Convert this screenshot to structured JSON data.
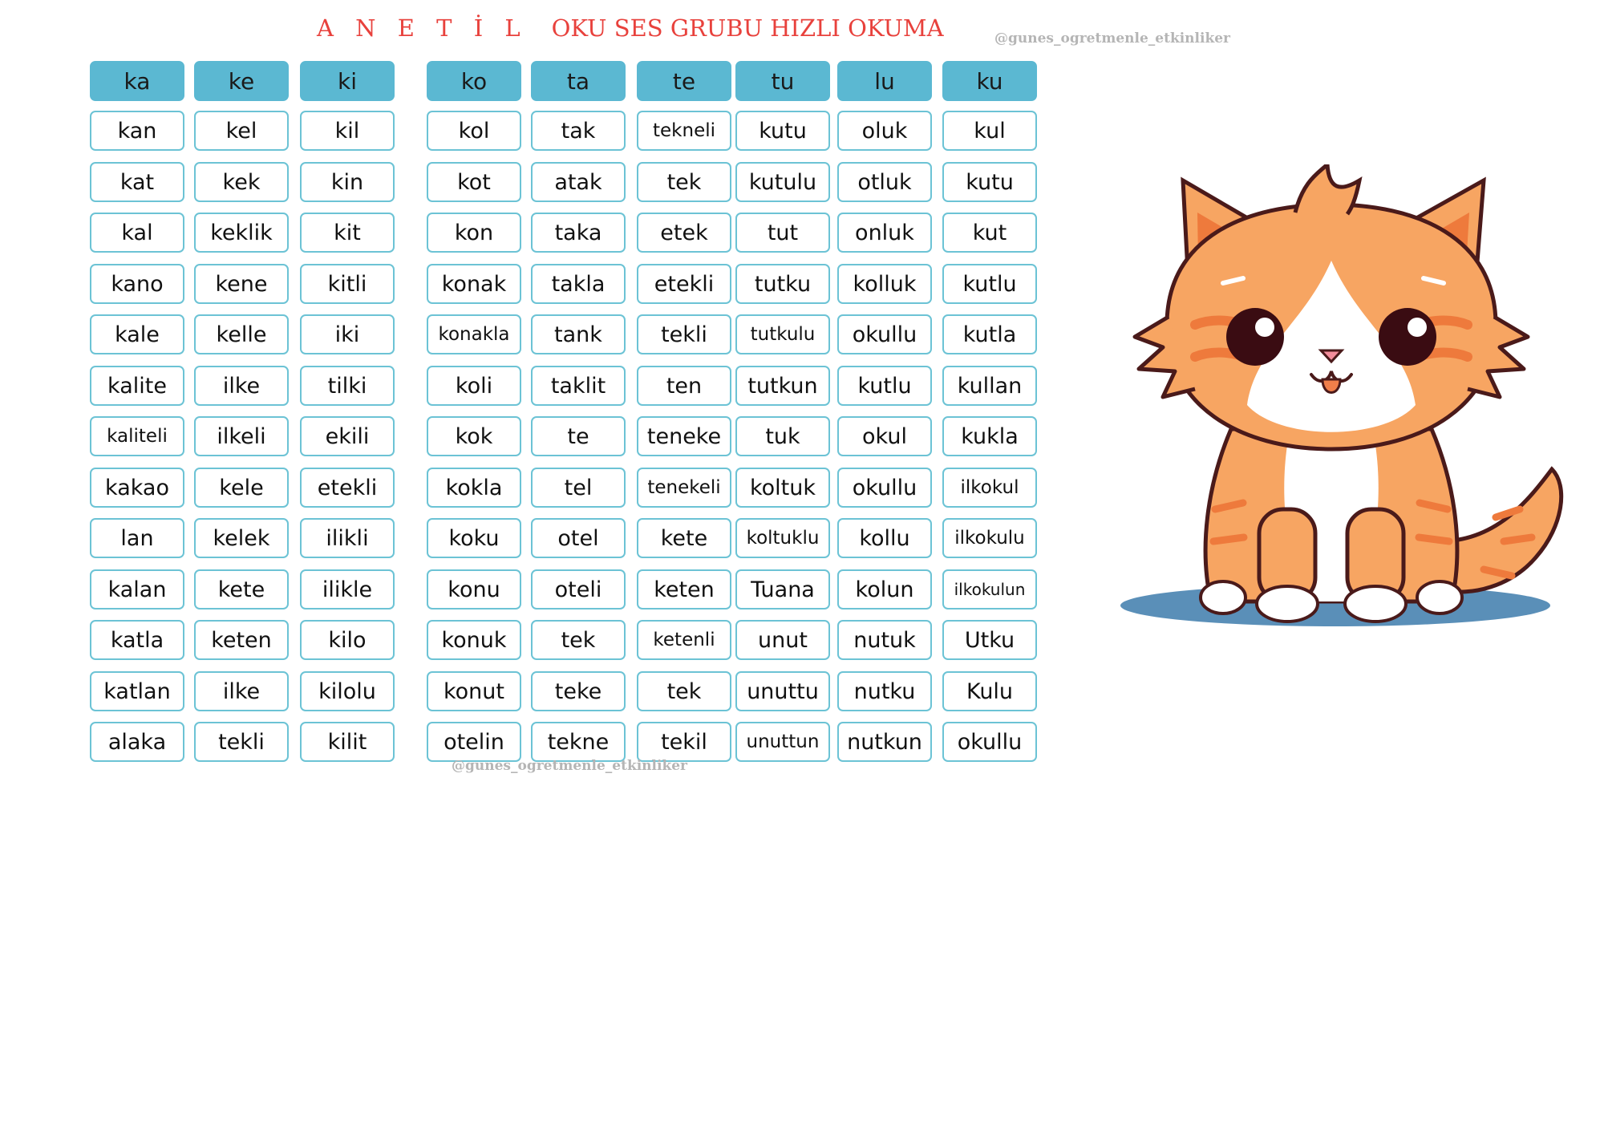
{
  "title": {
    "part1": "A N E T İ L",
    "part2": "OKU SES GRUBU HIZLI OKUMA"
  },
  "watermark": "@gunes_ogretmenle_etkinliker",
  "colors": {
    "title": "#e8413c",
    "header_fill": "#5bb8d2",
    "cell_border": "#6cc3d5"
  },
  "columns": [
    {
      "header": "ka",
      "words": [
        "kan",
        "kat",
        "kal",
        "kano",
        "kale",
        "kalite",
        "kaliteli",
        "kakao",
        "lan",
        "kalan",
        "katla",
        "katlan",
        "alaka"
      ]
    },
    {
      "header": "ke",
      "words": [
        "kel",
        "kek",
        "keklik",
        "kene",
        "kelle",
        "ilke",
        "ilkeli",
        "kele",
        "kelek",
        "kete",
        "keten",
        "ilke",
        "tekli"
      ]
    },
    {
      "header": "ki",
      "words": [
        "kil",
        "kin",
        "kit",
        "kitli",
        "iki",
        "tilki",
        "ekili",
        "etekli",
        "ilikli",
        "ilikle",
        "kilo",
        "kilolu",
        "kilit"
      ]
    },
    {
      "header": "ko",
      "words": [
        "kol",
        "kot",
        "kon",
        "konak",
        "konakla",
        "koli",
        "kok",
        "kokla",
        "koku",
        "konu",
        "konuk",
        "konut",
        "otelin"
      ]
    },
    {
      "header": "ta",
      "words": [
        "tak",
        "atak",
        "taka",
        "takla",
        "tank",
        "taklit",
        "te",
        "tel",
        "otel",
        "oteli",
        "tek",
        "teke",
        "tekne"
      ]
    },
    {
      "header": "te",
      "words": [
        "tekneli",
        "tek",
        "etek",
        "etekli",
        "tekli",
        "ten",
        "teneke",
        "tenekeli",
        "kete",
        "keten",
        "ketenli",
        "tek",
        "tekil"
      ]
    },
    {
      "header": "tu",
      "words": [
        "kutu",
        "kutulu",
        "tut",
        "tutku",
        "tutkulu",
        "tutkun",
        "tuk",
        "koltuk",
        "koltuklu",
        "Tuana",
        "unut",
        "unuttu",
        "unuttun"
      ]
    },
    {
      "header": "lu",
      "words": [
        "oluk",
        "otluk",
        "onluk",
        "kolluk",
        "okullu",
        "kutlu",
        "okul",
        "okullu",
        "kollu",
        "kolun",
        "nutuk",
        "nutku",
        "nutkun"
      ]
    },
    {
      "header": "ku",
      "words": [
        "kul",
        "kutu",
        "kut",
        "kutlu",
        "kutla",
        "kullan",
        "kukla",
        "ilkokul",
        "ilkokulu",
        "ilkokulun",
        "Utku",
        "Kulu",
        "okullu"
      ]
    }
  ],
  "illustration": {
    "subject": "cat-illustration"
  }
}
